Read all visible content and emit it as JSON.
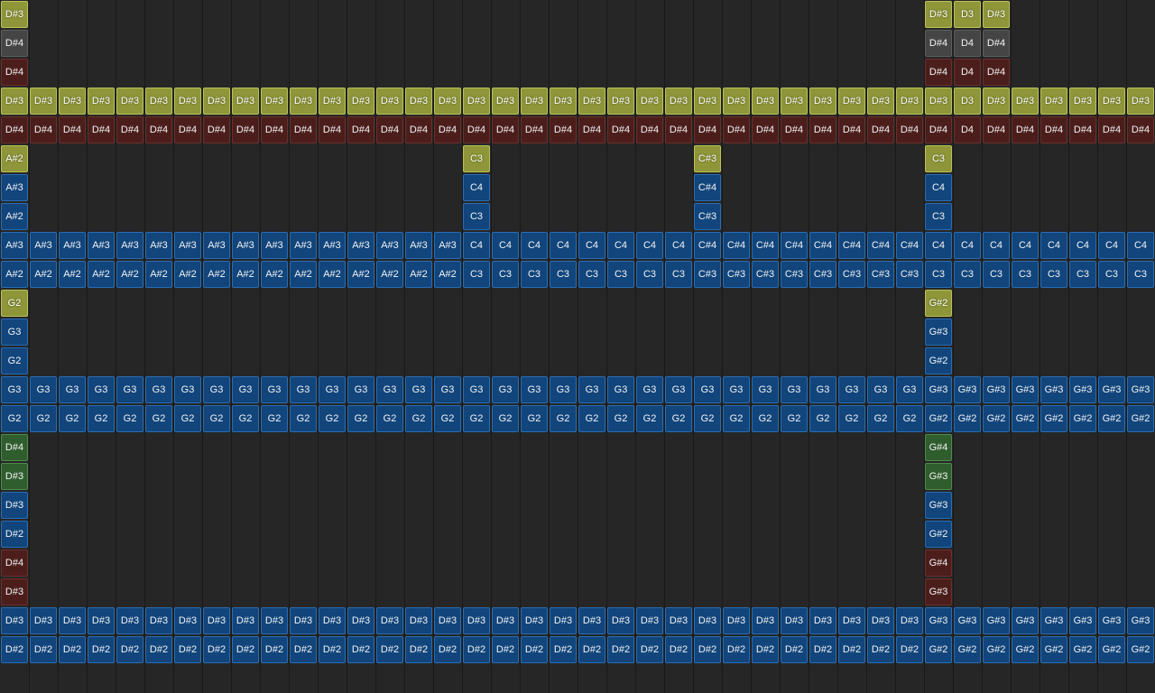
{
  "colors": {
    "background": "#262626",
    "blue": "#11457c",
    "olive": "#8e9639",
    "brown": "#4b1e1c",
    "gray": "#454545",
    "green": "#2f5d2e"
  },
  "columns": 40,
  "rows": [
    {
      "cells": [
        {
          "col": 0,
          "label": "D#3",
          "color": "olive"
        },
        {
          "col": 32,
          "label": "D#3",
          "color": "olive"
        },
        {
          "col": 33,
          "label": "D3",
          "color": "olive"
        },
        {
          "col": 34,
          "label": "D#3",
          "color": "olive"
        }
      ]
    },
    {
      "cells": [
        {
          "col": 0,
          "label": "D#4",
          "color": "gray"
        },
        {
          "col": 32,
          "label": "D#4",
          "color": "gray"
        },
        {
          "col": 33,
          "label": "D4",
          "color": "gray"
        },
        {
          "col": 34,
          "label": "D#4",
          "color": "gray"
        }
      ]
    },
    {
      "cells": [
        {
          "col": 0,
          "label": "D#4",
          "color": "brown"
        },
        {
          "col": 32,
          "label": "D#4",
          "color": "brown"
        },
        {
          "col": 33,
          "label": "D4",
          "color": "brown"
        },
        {
          "col": 34,
          "label": "D#4",
          "color": "brown"
        }
      ]
    },
    {
      "fill": {
        "color": "olive",
        "labels": [
          "D#3",
          "D#3",
          "D#3",
          "D#3",
          "D#3",
          "D#3",
          "D#3",
          "D#3",
          "D#3",
          "D#3",
          "D#3",
          "D#3",
          "D#3",
          "D#3",
          "D#3",
          "D#3",
          "D#3",
          "D#3",
          "D#3",
          "D#3",
          "D#3",
          "D#3",
          "D#3",
          "D#3",
          "D#3",
          "D#3",
          "D#3",
          "D#3",
          "D#3",
          "D#3",
          "D#3",
          "D#3",
          "D#3",
          "D3",
          "D#3",
          "D#3",
          "D#3",
          "D#3",
          "D#3",
          "D#3"
        ]
      }
    },
    {
      "fill": {
        "color": "brown",
        "labels": [
          "D#4",
          "D#4",
          "D#4",
          "D#4",
          "D#4",
          "D#4",
          "D#4",
          "D#4",
          "D#4",
          "D#4",
          "D#4",
          "D#4",
          "D#4",
          "D#4",
          "D#4",
          "D#4",
          "D#4",
          "D#4",
          "D#4",
          "D#4",
          "D#4",
          "D#4",
          "D#4",
          "D#4",
          "D#4",
          "D#4",
          "D#4",
          "D#4",
          "D#4",
          "D#4",
          "D#4",
          "D#4",
          "D#4",
          "D4",
          "D#4",
          "D#4",
          "D#4",
          "D#4",
          "D#4",
          "D#4"
        ]
      }
    },
    {
      "cells": [
        {
          "col": 0,
          "label": "A#2",
          "color": "olive"
        },
        {
          "col": 16,
          "label": "C3",
          "color": "olive"
        },
        {
          "col": 24,
          "label": "C#3",
          "color": "olive"
        },
        {
          "col": 32,
          "label": "C3",
          "color": "olive"
        }
      ]
    },
    {
      "cells": [
        {
          "col": 0,
          "label": "A#3",
          "color": "blue"
        },
        {
          "col": 16,
          "label": "C4",
          "color": "blue"
        },
        {
          "col": 24,
          "label": "C#4",
          "color": "blue"
        },
        {
          "col": 32,
          "label": "C4",
          "color": "blue"
        }
      ]
    },
    {
      "cells": [
        {
          "col": 0,
          "label": "A#2",
          "color": "blue"
        },
        {
          "col": 16,
          "label": "C3",
          "color": "blue"
        },
        {
          "col": 24,
          "label": "C#3",
          "color": "blue"
        },
        {
          "col": 32,
          "label": "C3",
          "color": "blue"
        }
      ]
    },
    {
      "fill": {
        "color": "blue",
        "labels": [
          "A#3",
          "A#3",
          "A#3",
          "A#3",
          "A#3",
          "A#3",
          "A#3",
          "A#3",
          "A#3",
          "A#3",
          "A#3",
          "A#3",
          "A#3",
          "A#3",
          "A#3",
          "A#3",
          "C4",
          "C4",
          "C4",
          "C4",
          "C4",
          "C4",
          "C4",
          "C4",
          "C#4",
          "C#4",
          "C#4",
          "C#4",
          "C#4",
          "C#4",
          "C#4",
          "C#4",
          "C4",
          "C4",
          "C4",
          "C4",
          "C4",
          "C4",
          "C4",
          "C4"
        ]
      }
    },
    {
      "fill": {
        "color": "blue",
        "labels": [
          "A#2",
          "A#2",
          "A#2",
          "A#2",
          "A#2",
          "A#2",
          "A#2",
          "A#2",
          "A#2",
          "A#2",
          "A#2",
          "A#2",
          "A#2",
          "A#2",
          "A#2",
          "A#2",
          "C3",
          "C3",
          "C3",
          "C3",
          "C3",
          "C3",
          "C3",
          "C3",
          "C#3",
          "C#3",
          "C#3",
          "C#3",
          "C#3",
          "C#3",
          "C#3",
          "C#3",
          "C3",
          "C3",
          "C3",
          "C3",
          "C3",
          "C3",
          "C3",
          "C3"
        ]
      }
    },
    {
      "cells": [
        {
          "col": 0,
          "label": "G2",
          "color": "olive"
        },
        {
          "col": 32,
          "label": "G#2",
          "color": "olive"
        }
      ]
    },
    {
      "cells": [
        {
          "col": 0,
          "label": "G3",
          "color": "blue"
        },
        {
          "col": 32,
          "label": "G#3",
          "color": "blue"
        }
      ]
    },
    {
      "cells": [
        {
          "col": 0,
          "label": "G2",
          "color": "blue"
        },
        {
          "col": 32,
          "label": "G#2",
          "color": "blue"
        }
      ]
    },
    {
      "fill": {
        "color": "blue",
        "labels": [
          "G3",
          "G3",
          "G3",
          "G3",
          "G3",
          "G3",
          "G3",
          "G3",
          "G3",
          "G3",
          "G3",
          "G3",
          "G3",
          "G3",
          "G3",
          "G3",
          "G3",
          "G3",
          "G3",
          "G3",
          "G3",
          "G3",
          "G3",
          "G3",
          "G3",
          "G3",
          "G3",
          "G3",
          "G3",
          "G3",
          "G3",
          "G3",
          "G#3",
          "G#3",
          "G#3",
          "G#3",
          "G#3",
          "G#3",
          "G#3",
          "G#3"
        ]
      }
    },
    {
      "fill": {
        "color": "blue",
        "labels": [
          "G2",
          "G2",
          "G2",
          "G2",
          "G2",
          "G2",
          "G2",
          "G2",
          "G2",
          "G2",
          "G2",
          "G2",
          "G2",
          "G2",
          "G2",
          "G2",
          "G2",
          "G2",
          "G2",
          "G2",
          "G2",
          "G2",
          "G2",
          "G2",
          "G2",
          "G2",
          "G2",
          "G2",
          "G2",
          "G2",
          "G2",
          "G2",
          "G#2",
          "G#2",
          "G#2",
          "G#2",
          "G#2",
          "G#2",
          "G#2",
          "G#2"
        ]
      }
    },
    {
      "cells": [
        {
          "col": 0,
          "label": "D#4",
          "color": "green"
        },
        {
          "col": 32,
          "label": "G#4",
          "color": "green"
        }
      ]
    },
    {
      "cells": [
        {
          "col": 0,
          "label": "D#3",
          "color": "green"
        },
        {
          "col": 32,
          "label": "G#3",
          "color": "green"
        }
      ]
    },
    {
      "cells": [
        {
          "col": 0,
          "label": "D#3",
          "color": "blue"
        },
        {
          "col": 32,
          "label": "G#3",
          "color": "blue"
        }
      ]
    },
    {
      "cells": [
        {
          "col": 0,
          "label": "D#2",
          "color": "blue"
        },
        {
          "col": 32,
          "label": "G#2",
          "color": "blue"
        }
      ]
    },
    {
      "cells": [
        {
          "col": 0,
          "label": "D#4",
          "color": "brown"
        },
        {
          "col": 32,
          "label": "G#4",
          "color": "brown"
        }
      ]
    },
    {
      "cells": [
        {
          "col": 0,
          "label": "D#3",
          "color": "brown"
        },
        {
          "col": 32,
          "label": "G#3",
          "color": "brown"
        }
      ]
    },
    {
      "fill": {
        "color": "blue",
        "labels": [
          "D#3",
          "D#3",
          "D#3",
          "D#3",
          "D#3",
          "D#3",
          "D#3",
          "D#3",
          "D#3",
          "D#3",
          "D#3",
          "D#3",
          "D#3",
          "D#3",
          "D#3",
          "D#3",
          "D#3",
          "D#3",
          "D#3",
          "D#3",
          "D#3",
          "D#3",
          "D#3",
          "D#3",
          "D#3",
          "D#3",
          "D#3",
          "D#3",
          "D#3",
          "D#3",
          "D#3",
          "D#3",
          "G#3",
          "G#3",
          "G#3",
          "G#3",
          "G#3",
          "G#3",
          "G#3",
          "G#3"
        ]
      }
    },
    {
      "fill": {
        "color": "blue",
        "labels": [
          "D#2",
          "D#2",
          "D#2",
          "D#2",
          "D#2",
          "D#2",
          "D#2",
          "D#2",
          "D#2",
          "D#2",
          "D#2",
          "D#2",
          "D#2",
          "D#2",
          "D#2",
          "D#2",
          "D#2",
          "D#2",
          "D#2",
          "D#2",
          "D#2",
          "D#2",
          "D#2",
          "D#2",
          "D#2",
          "D#2",
          "D#2",
          "D#2",
          "D#2",
          "D#2",
          "D#2",
          "D#2",
          "G#2",
          "G#2",
          "G#2",
          "G#2",
          "G#2",
          "G#2",
          "G#2",
          "G#2"
        ]
      }
    },
    {
      "cells": []
    }
  ]
}
